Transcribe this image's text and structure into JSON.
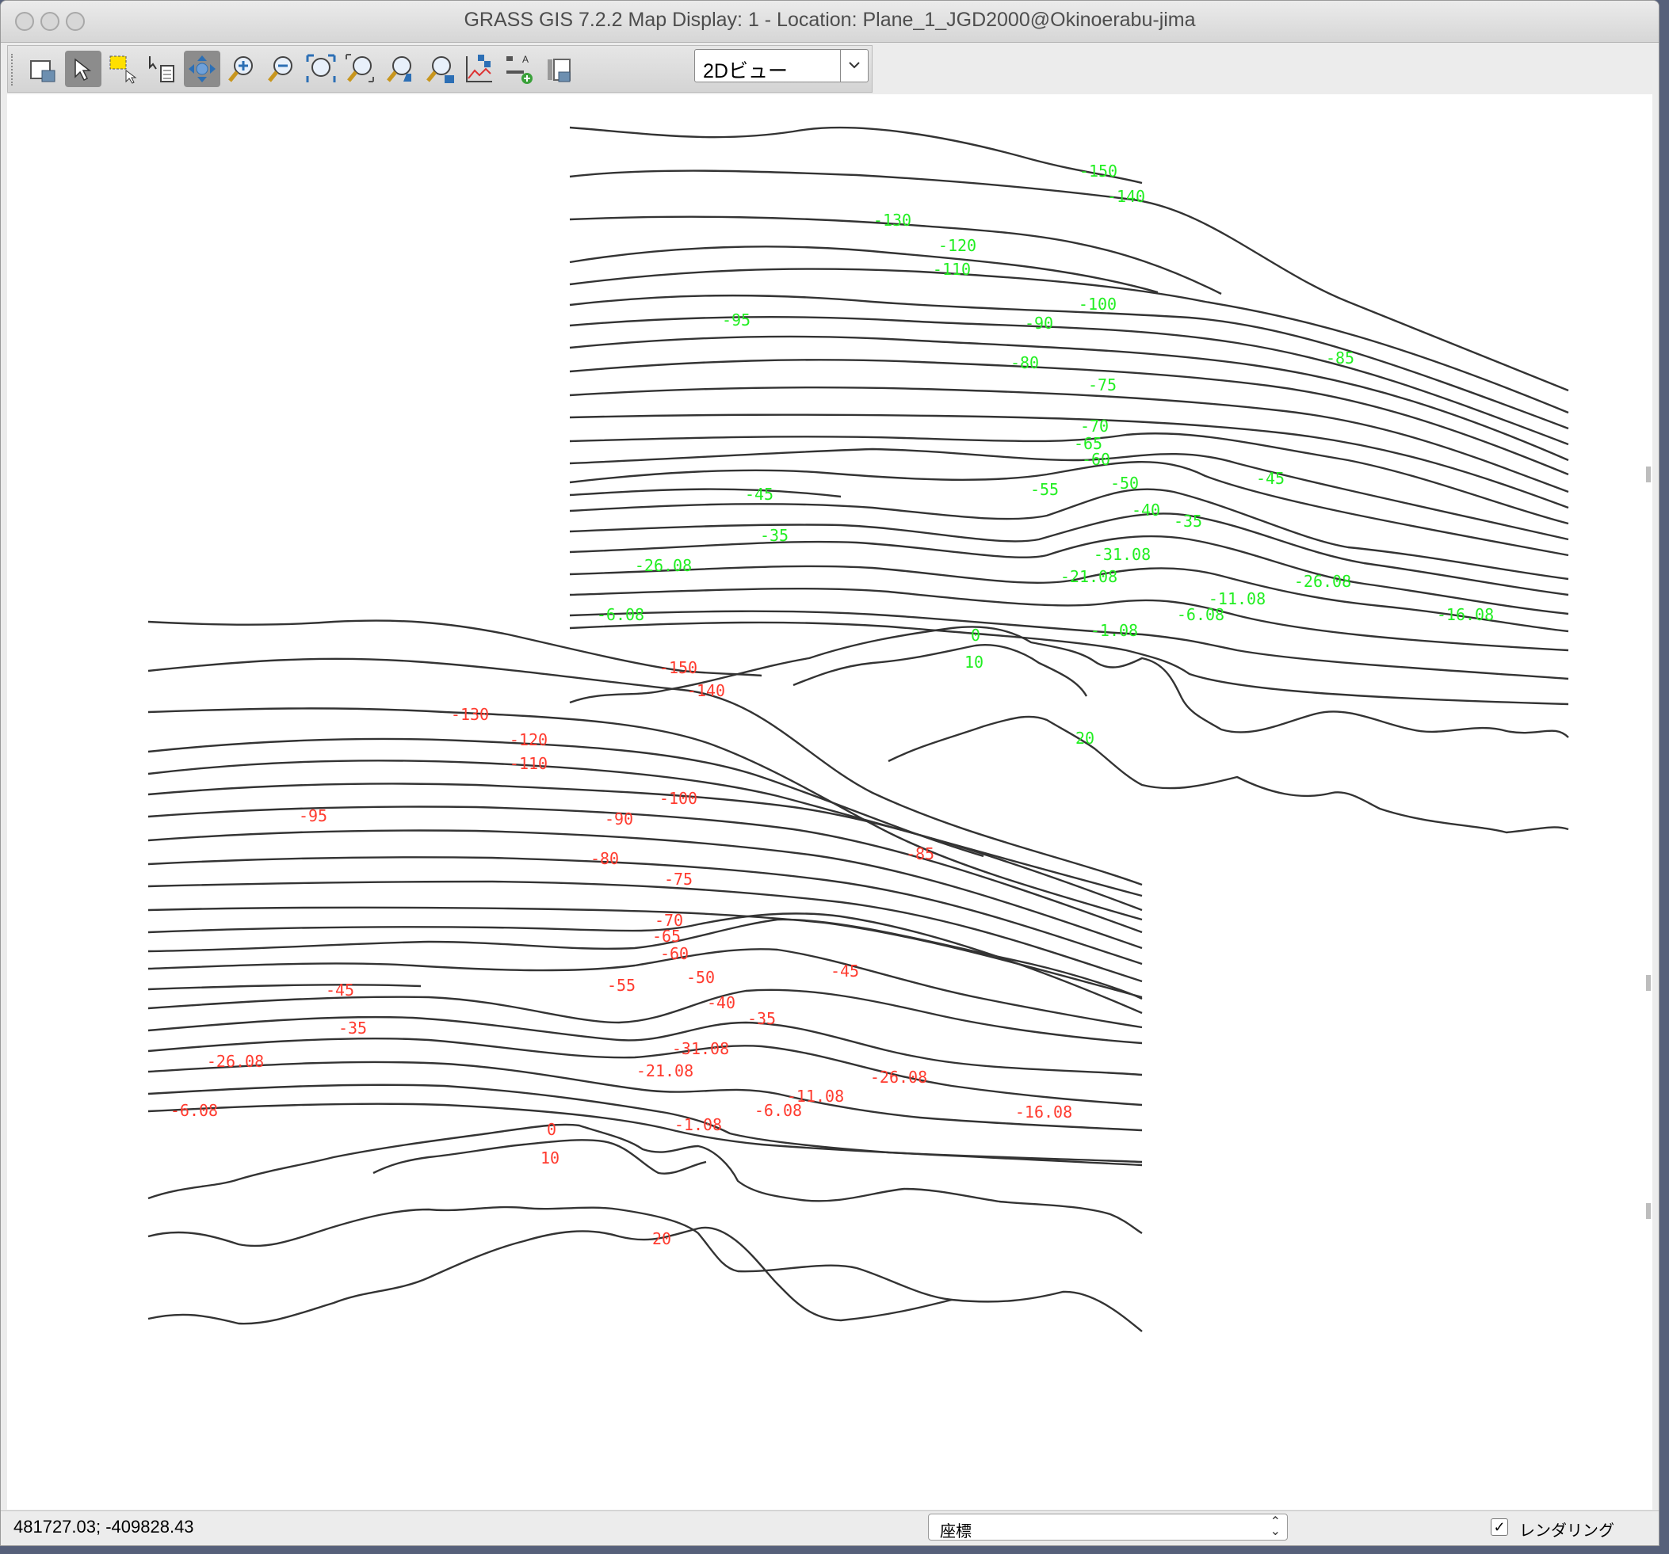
{
  "window": {
    "title": "GRASS GIS 7.2.2 Map Display: 1 - Location: Plane_1_JGD2000@Okinoerabu-jima"
  },
  "toolbar": {
    "tools": [
      {
        "name": "display-map-icon"
      },
      {
        "name": "pointer-icon",
        "active": true
      },
      {
        "name": "select-features-icon"
      },
      {
        "name": "query-icon"
      },
      {
        "name": "pan-icon",
        "active": true
      },
      {
        "name": "zoom-in-icon"
      },
      {
        "name": "zoom-out-icon"
      },
      {
        "name": "zoom-extent-icon"
      },
      {
        "name": "zoom-region-icon"
      },
      {
        "name": "zoom-back-icon"
      },
      {
        "name": "zoom-menu-icon"
      },
      {
        "name": "analyze-icon"
      },
      {
        "name": "overlay-icon"
      },
      {
        "name": "save-image-icon"
      }
    ],
    "view_mode": "2Dビュー"
  },
  "map": {
    "label_colors": {
      "upper": "#22ee22",
      "lower": "#ff3b2f"
    },
    "upper_labels": [
      "-150",
      "-140",
      "-130",
      "-120",
      "-110",
      "-100",
      "-95",
      "-90",
      "-85",
      "-80",
      "-75",
      "-70",
      "-65",
      "-60",
      "-55",
      "-50",
      "-45",
      "-45",
      "-40",
      "-35",
      "-35",
      "-31.08",
      "-26.08",
      "-26.08",
      "-21.08",
      "-11.08",
      "-6.08",
      "-6.08",
      "-1.08",
      "-16.08",
      "0",
      "10",
      "20"
    ],
    "lower_labels": [
      "-150",
      "-140",
      "-130",
      "-120",
      "-110",
      "-100",
      "-95",
      "-90",
      "-85",
      "-80",
      "-75",
      "-70",
      "-65",
      "-60",
      "-55",
      "-50",
      "-45",
      "-45",
      "-40",
      "-35",
      "-35",
      "-31.08",
      "-26.08",
      "-26.08",
      "-21.08",
      "-11.08",
      "-6.08",
      "-6.08",
      "-1.08",
      "-16.08",
      "0",
      "10",
      "20"
    ]
  },
  "status": {
    "coordinates": "481727.03; -409828.43",
    "mode": "座標",
    "render_label": "レンダリング",
    "render_checked": true
  }
}
